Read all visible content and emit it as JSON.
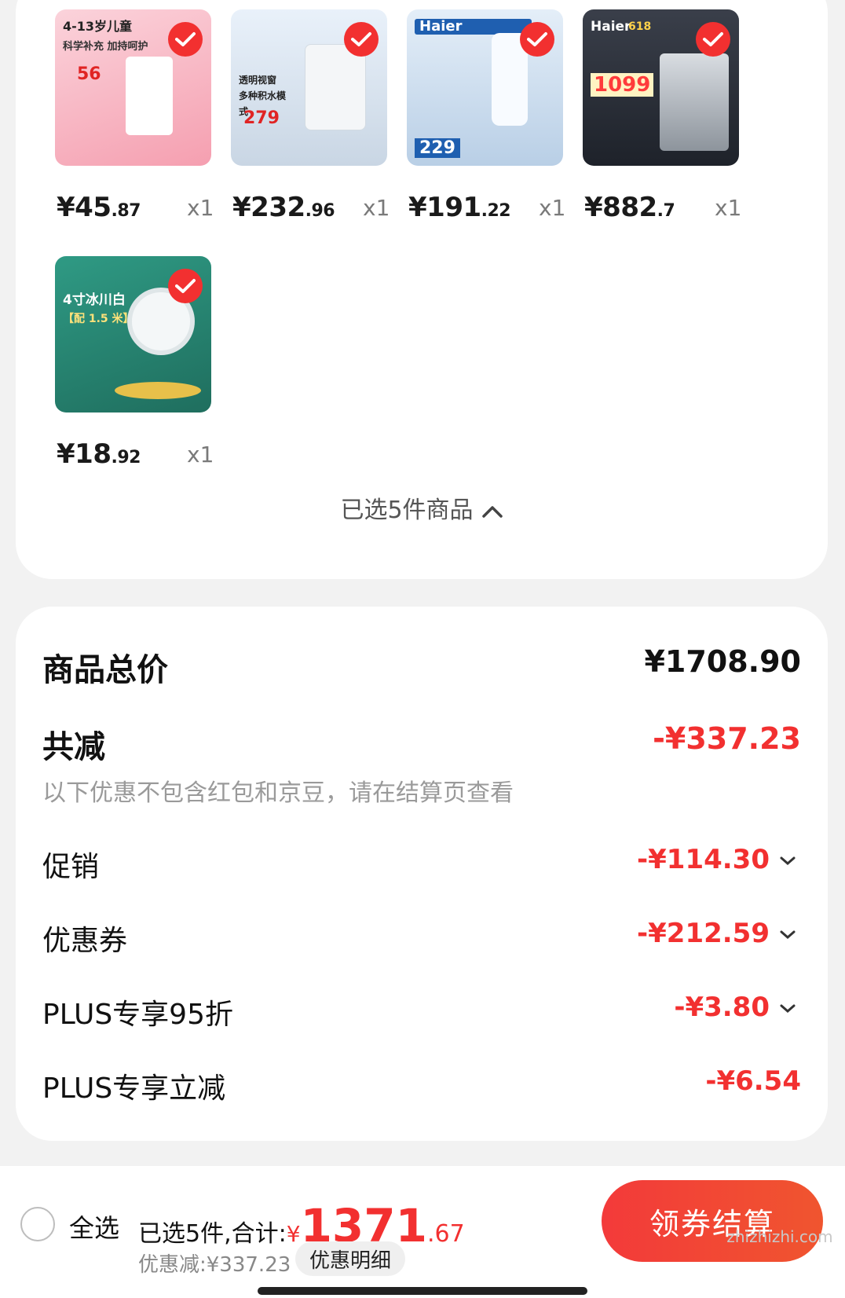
{
  "products": [
    {
      "thumb_title": "4-13岁儿童",
      "thumb_sub": "科学补充 加持呵护",
      "thumb_price": "56",
      "thumb_bg": "#f7c7cf",
      "price_int": "¥45",
      "price_dec": ".87",
      "qty": "x1",
      "check_icon": "check-icon"
    },
    {
      "thumb_title": "透明视窗 多种积水模式",
      "thumb_sub": "",
      "thumb_price": "279",
      "thumb_bg": "#e4edf7",
      "price_int": "¥232",
      "price_dec": ".96",
      "qty": "x1",
      "check_icon": "check-icon"
    },
    {
      "thumb_title": "Haier",
      "thumb_sub": "",
      "thumb_price": "229",
      "thumb_bg": "#dbe9f6",
      "price_int": "¥191",
      "price_dec": ".22",
      "qty": "x1",
      "check_icon": "check-icon"
    },
    {
      "thumb_title": "Haier",
      "thumb_sub": "618",
      "thumb_price": "1099",
      "thumb_bg": "#2d3340",
      "price_int": "¥882",
      "price_dec": ".7",
      "qty": "x1",
      "check_icon": "check-icon"
    },
    {
      "thumb_title": "4寸冰川白",
      "thumb_sub": "【配 1.5 米】",
      "thumb_price": "",
      "thumb_bg": "#2a8c78",
      "price_int": "¥18",
      "price_dec": ".92",
      "qty": "x1",
      "check_icon": "check-icon"
    }
  ],
  "selected_toggle": "已选5件商品",
  "summary": {
    "total_label": "商品总价",
    "total_value": "¥1708.90",
    "reduce_label": "共减",
    "reduce_value": "-¥337.23",
    "note": "以下优惠不包含红包和京豆，请在结算页查看",
    "items": [
      {
        "label": "促销",
        "value": "-¥114.30",
        "expand": true
      },
      {
        "label": "优惠券",
        "value": "-¥212.59",
        "expand": true
      },
      {
        "label": "PLUS专享95折",
        "value": "-¥3.80",
        "expand": true
      },
      {
        "label": "PLUS专享立减",
        "value": "-¥6.54",
        "expand": false
      }
    ]
  },
  "bottom": {
    "select_all": "全选",
    "selected_prefix": "已选5件,合计:",
    "total_currency": "¥",
    "total_int": "1371",
    "total_dec": ".67",
    "discount_text": "优惠减:¥337.23",
    "detail_btn": "优惠明细",
    "checkout_btn": "领券结算"
  },
  "watermark": "zhizhizhi.com",
  "colors": {
    "accent": "#f23030",
    "card": "#ffffff",
    "bg": "#f2f2f2"
  }
}
